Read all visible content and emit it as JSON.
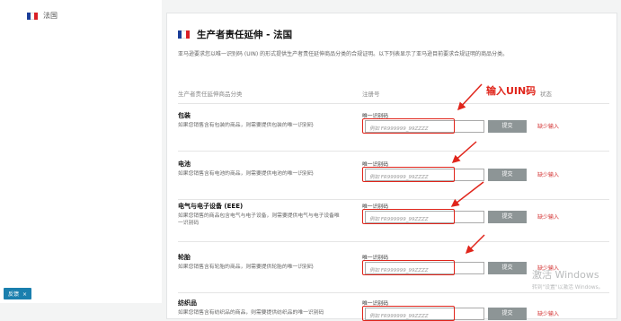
{
  "sidebar": {
    "country_label": "法国",
    "tag": {
      "label": "反馈",
      "close": "×"
    }
  },
  "page": {
    "title": "生产者责任延伸 - 法国",
    "description": "亚马逊要求您以唯一识别码 (UIN) 的形式提供生产者责任延伸商品分类的合规证明。以下列表显示了亚马逊目前要求合规证明的商品分类。",
    "headers": {
      "category": "生产者责任延伸商品分类",
      "registration": "注册号",
      "status": "状态"
    }
  },
  "annotation": "输入UIN码",
  "field_label": "唯一识别码",
  "placeholder": "例如 FR999999_99ZZZZ",
  "submit_label": "提交",
  "rows": [
    {
      "name": "包装",
      "desc": "如果您销售含有包装的商品，则需要提供包装的唯一识别码",
      "status": "缺少输入"
    },
    {
      "name": "电池",
      "desc": "如果您销售含有电池的商品，则需要提供电池的唯一识别码",
      "status": "缺少输入"
    },
    {
      "name": "电气与电子设备 (EEE)",
      "desc": "如果您销售的商品包含电气与电子设备，则需要提供电气与电子设备唯一识别码",
      "status": "缺少输入"
    },
    {
      "name": "轮胎",
      "desc": "如果您销售含有轮胎的商品，则需要提供轮胎的唯一识别码",
      "status": "缺少输入"
    },
    {
      "name": "纺织品",
      "desc": "如果您销售含有纺织品的商品，则需要提供纺织品的唯一识别码",
      "status": "缺少输入"
    }
  ],
  "watermark": {
    "line1": "激活 Windows",
    "line2": "转到\"设置\"以激活 Windows。"
  },
  "colors": {
    "accent_red": "#e0251b",
    "submit_gray": "#8d9596",
    "tag_blue": "#1a7fae"
  }
}
